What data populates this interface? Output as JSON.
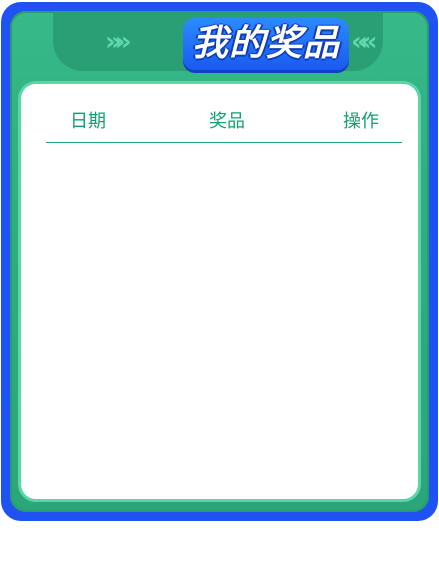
{
  "dialog": {
    "title": "我的奖品",
    "decor_left": "»»",
    "decor_right": "««",
    "colors": {
      "frame": "#1f52f2",
      "panel_green": "#2fae80",
      "accent_text": "#13a06f",
      "title_badge": "#1a5af0"
    }
  },
  "table": {
    "columns": [
      "日期",
      "奖品",
      "操作"
    ],
    "rows": []
  }
}
